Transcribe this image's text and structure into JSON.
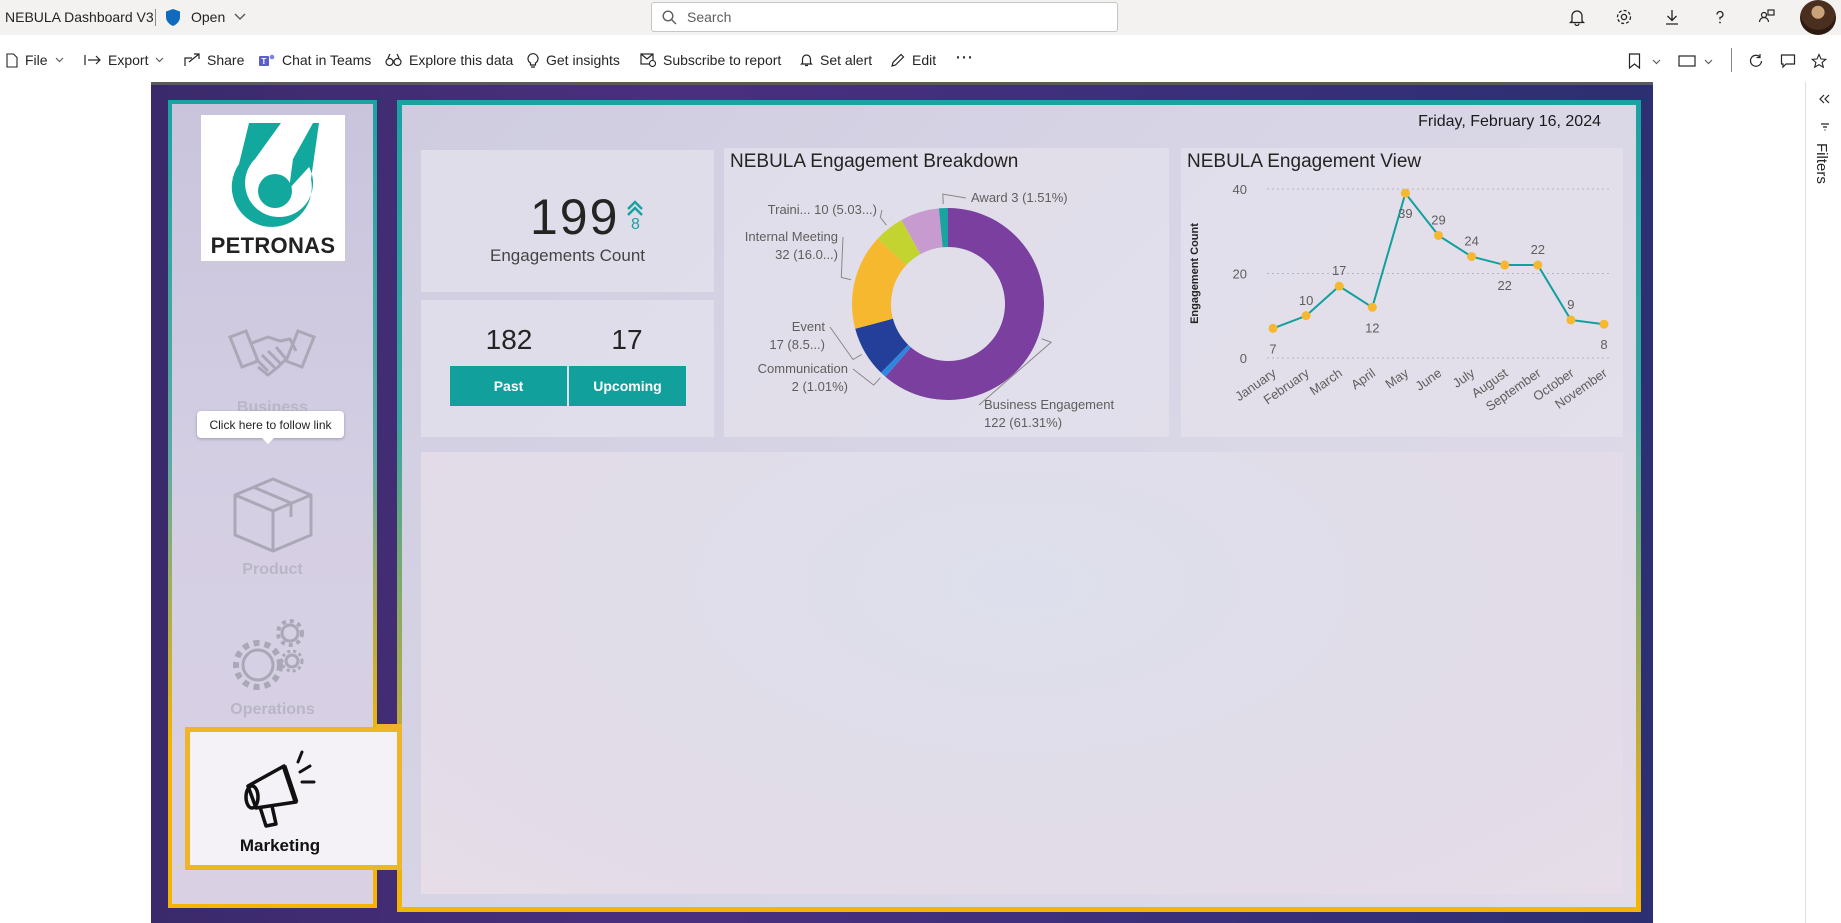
{
  "topbar": {
    "app_title": "NEBULA Dashboard V3",
    "sensitivity": "Open",
    "search_placeholder": "Search"
  },
  "commands": {
    "file": "File",
    "export": "Export",
    "share": "Share",
    "chat": "Chat in Teams",
    "explore": "Explore this data",
    "insights": "Get insights",
    "subscribe": "Subscribe to report",
    "alert": "Set alert",
    "edit": "Edit",
    "more": "⋯"
  },
  "report": {
    "date": "Friday, February 16, 2024",
    "logo_text": "PETRONAS",
    "nav": {
      "business": "Business",
      "tooltip": "Click here to follow link",
      "product": "Product",
      "operations": "Operations",
      "marketing": "Marketing"
    },
    "kpi": {
      "count": "199",
      "delta": "8",
      "label": "Engagements Count",
      "past_value": "182",
      "upcoming_value": "17",
      "past_label": "Past",
      "upcoming_label": "Upcoming"
    }
  },
  "filters_label": "Filters",
  "colors": {
    "teal": "#11a09c",
    "gold": "#f0b429",
    "purple": "#7b3fa0"
  },
  "chart_data": [
    {
      "type": "pie",
      "title": "NEBULA Engagement Breakdown",
      "slices": [
        {
          "label": "Business Engagement",
          "value": 122,
          "display": "122 (61.31%)",
          "color": "#7b3fa0"
        },
        {
          "label": "Communication",
          "value": 2,
          "display": "2 (1.01%)",
          "color": "#2e86de"
        },
        {
          "label": "Event",
          "value": 17,
          "display": "17 (8.5...)",
          "color": "#233f9a"
        },
        {
          "label": "Internal Meeting",
          "value": 32,
          "display": "32 (16.0...)",
          "color": "#f5b82e"
        },
        {
          "label": "Traini...",
          "value": 10,
          "display": "10 (5.03...)",
          "color": "#c3d431"
        },
        {
          "label": "",
          "value": 13,
          "display": "",
          "color": "#c79bcf"
        },
        {
          "label": "Award",
          "value": 3,
          "display": "3 (1.51%)",
          "color": "#1aa3a1"
        }
      ]
    },
    {
      "type": "line",
      "title": "NEBULA Engagement View",
      "ylabel": "Engagement Count",
      "ylim": [
        0,
        40
      ],
      "yticks": [
        "0",
        "20",
        "40"
      ],
      "categories": [
        "January",
        "February",
        "March",
        "April",
        "May",
        "June",
        "July",
        "August",
        "September",
        "October",
        "November"
      ],
      "values": [
        7,
        10,
        17,
        12,
        39,
        29,
        24,
        22,
        22,
        9,
        8
      ],
      "labels": [
        "7",
        "10",
        "17",
        "12",
        "39",
        "29",
        "24",
        "22",
        "22",
        "9",
        "8"
      ],
      "line_color": "#11a09c",
      "marker_color": "#f5b82e"
    }
  ]
}
